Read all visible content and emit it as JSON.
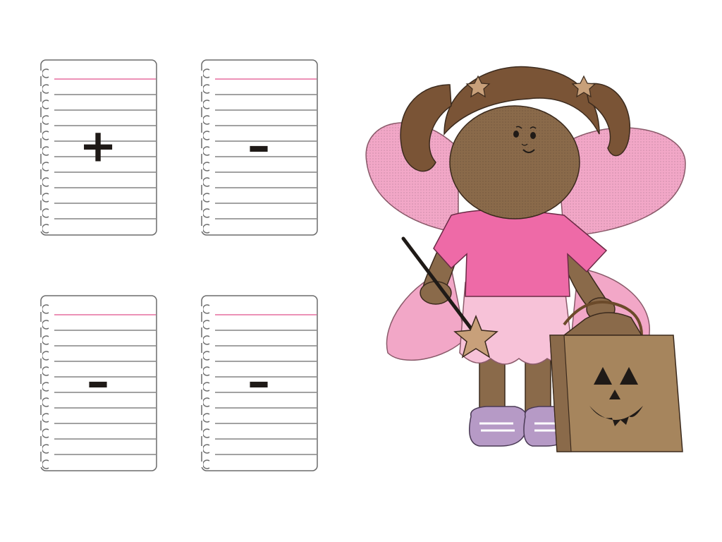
{
  "cards": [
    {
      "symbol": "+"
    },
    {
      "symbol": "–"
    },
    {
      "symbol": "–"
    },
    {
      "symbol": "–"
    }
  ],
  "colors": {
    "paper": "#ffffff",
    "rule": "#6b6b6b",
    "margin_rule": "#e0508c",
    "ink": "#1f1a17",
    "wings": "#f2a7c7",
    "shirt": "#ee6aa7",
    "skirt": "#f7c2d8",
    "skin": "#8a6a4a",
    "hair": "#7a5436",
    "bag": "#a6855d",
    "shoes": "#b69ac6"
  },
  "icons": [
    "notepad-card-icon",
    "fairy-girl-illustration",
    "magic-wand-icon",
    "pumpkin-bag-icon"
  ]
}
